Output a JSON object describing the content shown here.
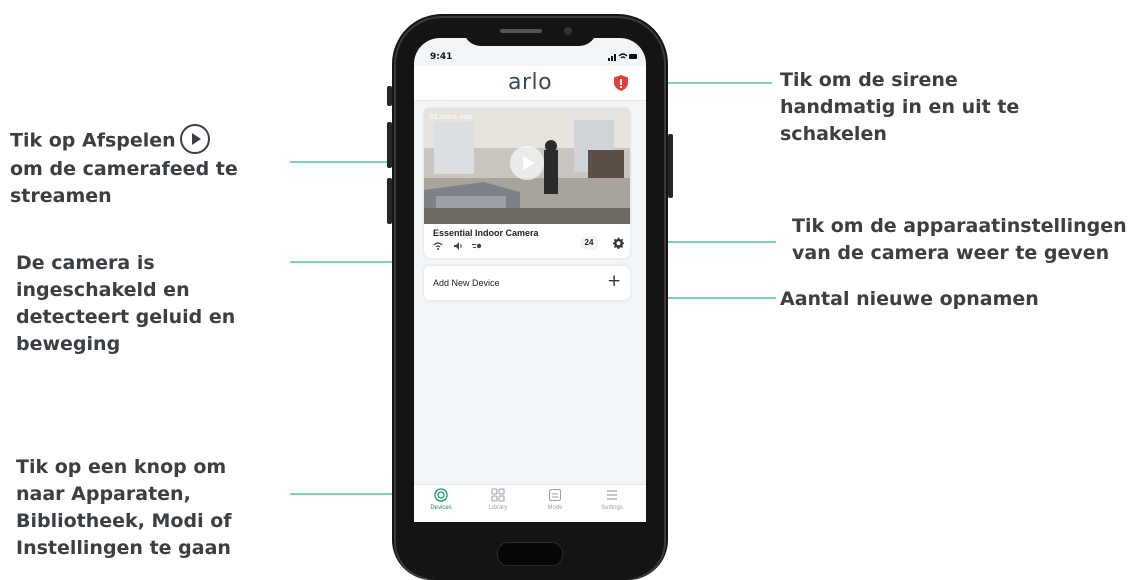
{
  "phone": {
    "status_time": "9:41",
    "status_icons": "signal-wifi-battery",
    "logo": "arlo",
    "camera_card": {
      "time_ago": "32 mins ago",
      "name": "Essential Indoor Camera",
      "recording_count": "24"
    },
    "add_device_label": "Add New Device",
    "nav": [
      {
        "label": "Devices",
        "icon": "devices-icon",
        "active": true
      },
      {
        "label": "Library",
        "icon": "library-icon",
        "active": false
      },
      {
        "label": "Mode",
        "icon": "mode-icon",
        "active": false
      },
      {
        "label": "Settings",
        "icon": "settings-icon",
        "active": false
      }
    ]
  },
  "annotations": {
    "play": {
      "line1": "Tik op Afspelen",
      "line2": "om de camerafeed te",
      "line3": "streamen"
    },
    "status": {
      "line1": "De camera is",
      "line2": "ingeschakeld en",
      "line3": "detecteert geluid en",
      "line4": "beweging"
    },
    "nav": {
      "line1": "Tik op een knop om",
      "line2": "naar Apparaten,",
      "line3": "Bibliotheek, Modi of",
      "line4": "Instellingen te gaan"
    },
    "siren": {
      "line1": "Tik om de sirene",
      "line2": "handmatig in en uit te",
      "line3": "schakelen"
    },
    "settings": {
      "line1": "Tik om de apparaatinstellingen",
      "line2": "van de camera weer te geven"
    },
    "recordings": {
      "line1": "Aantal nieuwe opnamen"
    }
  },
  "colors": {
    "accent": "#7fcfb5",
    "siren": "#e0403b",
    "text": "#3a3f44"
  }
}
